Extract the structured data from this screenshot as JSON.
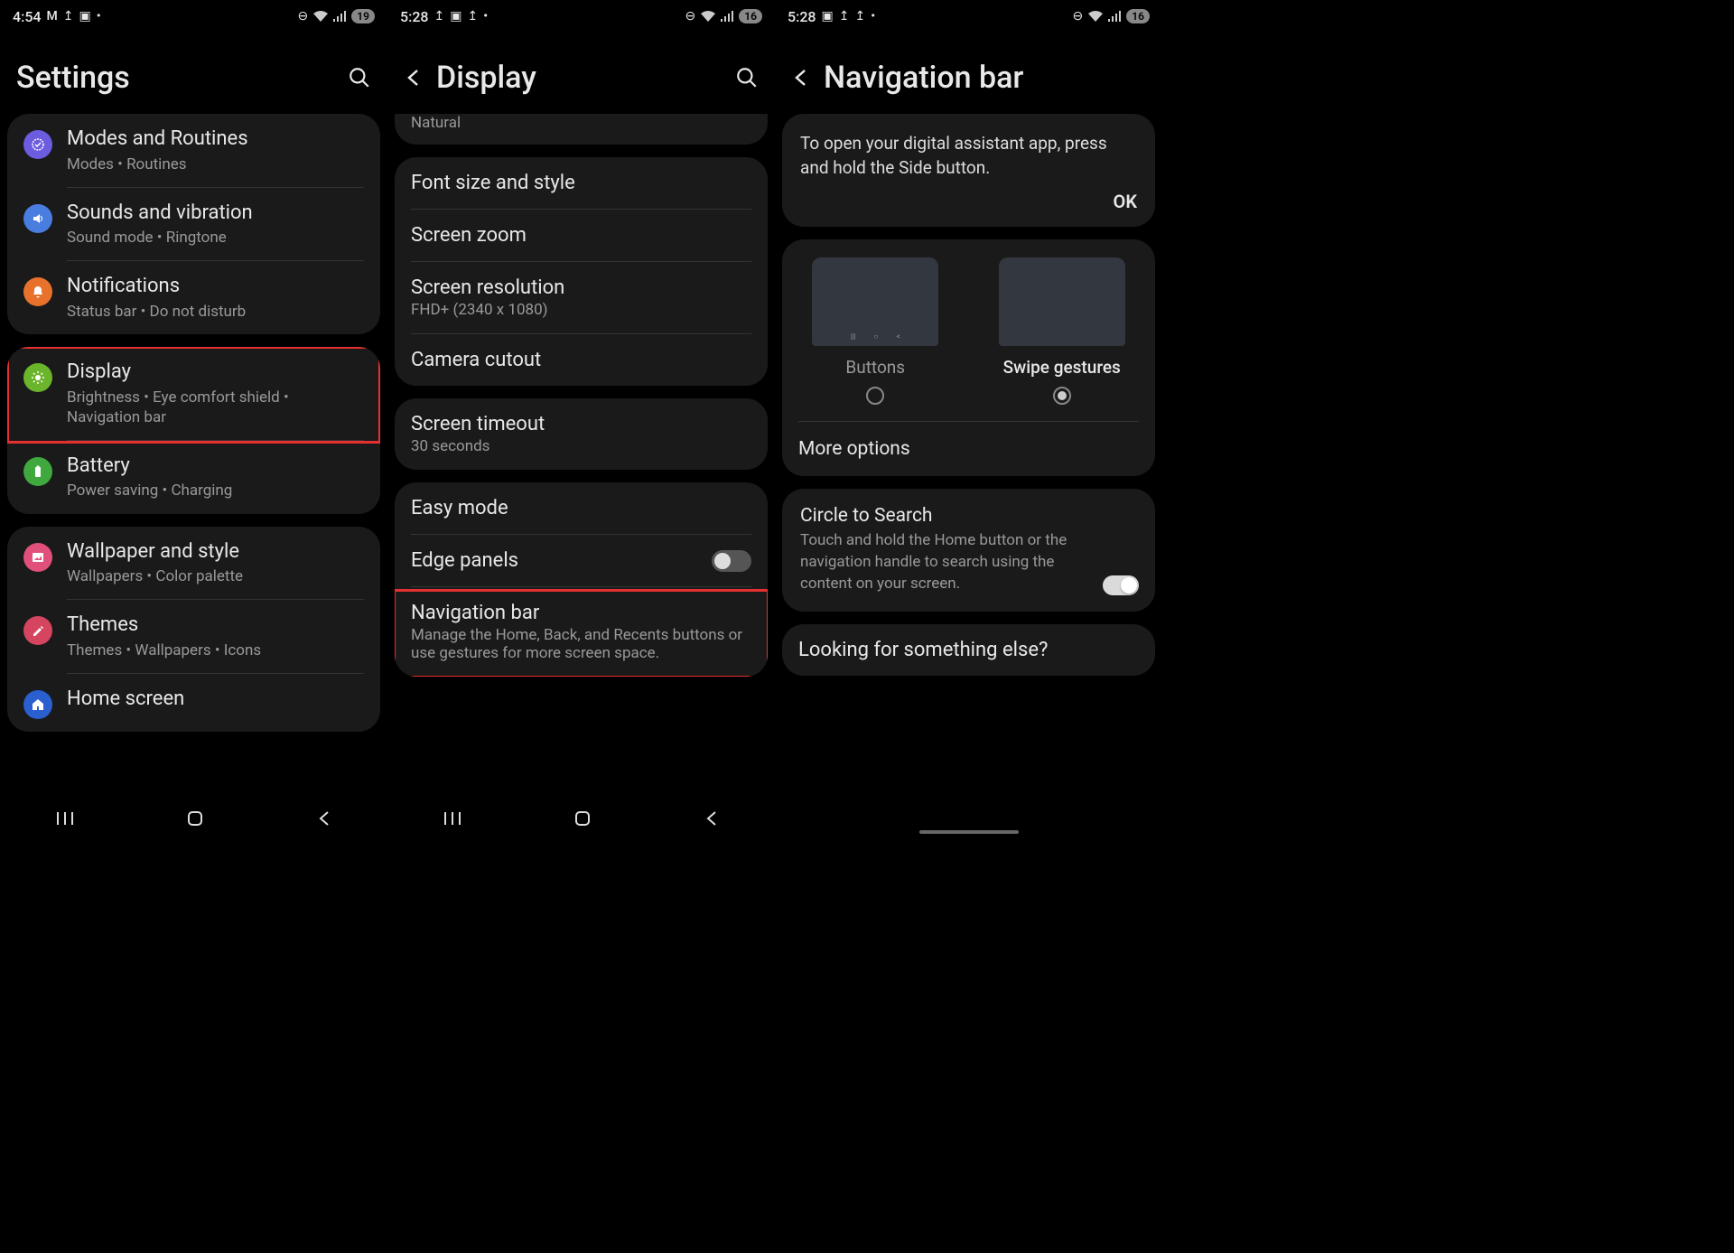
{
  "s1": {
    "time": "4:54",
    "battery": "19",
    "title": "Settings",
    "items": {
      "modes": {
        "title": "Modes and Routines",
        "sub": "Modes • Routines"
      },
      "sounds": {
        "title": "Sounds and vibration",
        "sub": "Sound mode • Ringtone"
      },
      "notif": {
        "title": "Notifications",
        "sub": "Status bar • Do not disturb"
      },
      "display": {
        "title": "Display",
        "sub": "Brightness • Eye comfort shield • Navigation bar"
      },
      "battery": {
        "title": "Battery",
        "sub": "Power saving • Charging"
      },
      "wallpaper": {
        "title": "Wallpaper and style",
        "sub": "Wallpapers • Color palette"
      },
      "themes": {
        "title": "Themes",
        "sub": "Themes • Wallpapers • Icons"
      },
      "home": {
        "title": "Home screen"
      }
    }
  },
  "s2": {
    "time": "5:28",
    "battery": "16",
    "title": "Display",
    "peek": "Natural",
    "items": {
      "font": "Font size and style",
      "zoom": "Screen zoom",
      "res": {
        "title": "Screen resolution",
        "sub": "FHD+ (2340 x 1080)"
      },
      "cutout": "Camera cutout",
      "timeout": {
        "title": "Screen timeout",
        "sub": "30 seconds"
      },
      "easy": "Easy mode",
      "edge": "Edge panels",
      "nav": {
        "title": "Navigation bar",
        "sub": "Manage the Home, Back, and Recents buttons or use gestures for more screen space."
      }
    }
  },
  "s3": {
    "time": "5:28",
    "battery": "16",
    "title": "Navigation bar",
    "info": "To open your digital assistant app, press and hold the Side button.",
    "ok": "OK",
    "buttons_label": "Buttons",
    "swipe_label": "Swipe gestures",
    "more": "More options",
    "cts": {
      "title": "Circle to Search",
      "sub": "Touch and hold the Home button or the navigation handle to search using the content on your screen."
    },
    "looking": "Looking for something else?"
  }
}
